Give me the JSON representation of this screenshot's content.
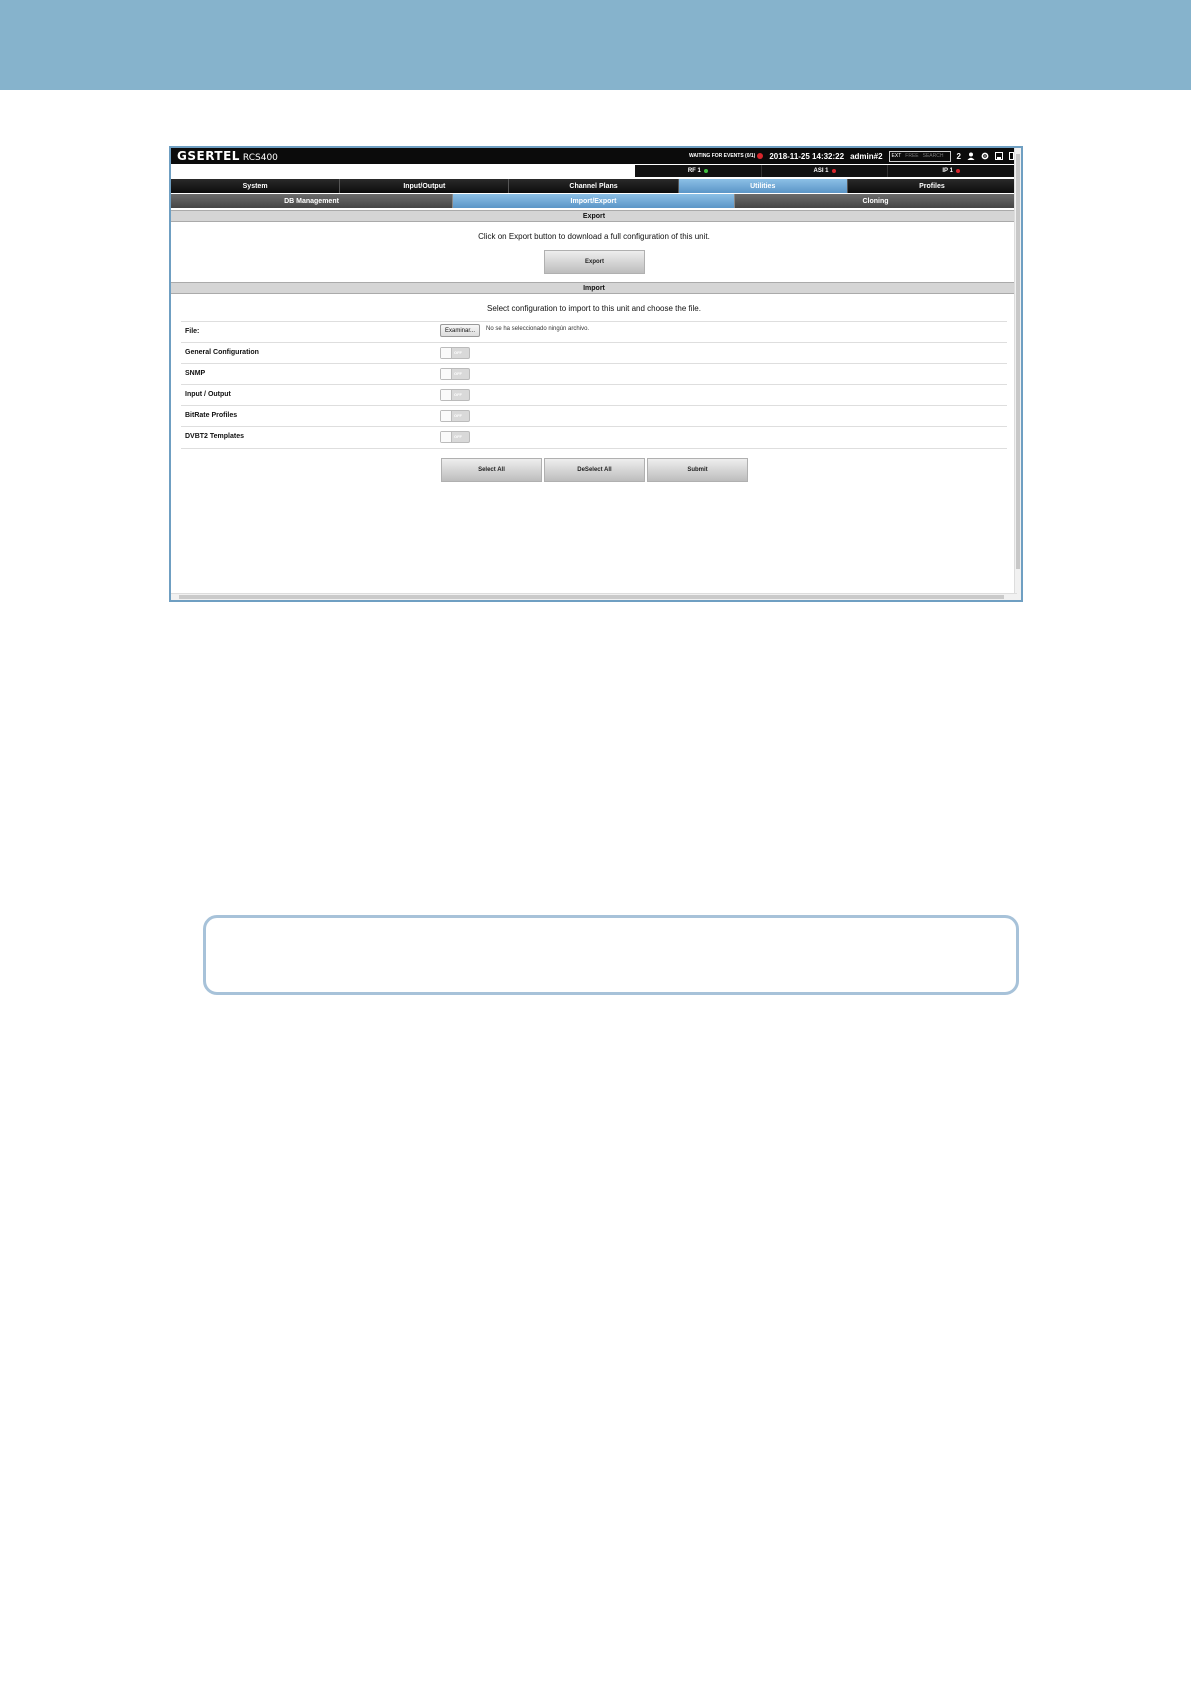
{
  "app": {
    "brand": "GSERTEL",
    "model": "RCS400",
    "status": "WAITING FOR EVENTS (0/1)",
    "datetime": "2018-11-25 14:32:22",
    "user": "admin#2",
    "ext_modes": [
      "EXT",
      "FREE",
      "SEARCH"
    ],
    "user_count": "2"
  },
  "status_blocks": [
    {
      "label": "RF 1",
      "dot_color": "#3fbf3f"
    },
    {
      "label": "ASI 1",
      "dot_color": "#d9262c"
    },
    {
      "label": "IP 1",
      "dot_color": "#d9262c"
    }
  ],
  "tabs": [
    "System",
    "Input/Output",
    "Channel Plans",
    "Utilities",
    "Profiles"
  ],
  "active_tab": "Utilities",
  "subtabs": [
    "DB Management",
    "Import/Export",
    "Cloning"
  ],
  "active_subtab": "Import/Export",
  "export": {
    "title": "Export",
    "message": "Click on Export button to download a full configuration of this unit.",
    "button": "Export"
  },
  "import": {
    "title": "Import",
    "message": "Select configuration to import to this unit and choose the file.",
    "file_label": "File:",
    "file_button": "Examinar...",
    "file_status": "No se ha seleccionado ningún archivo.",
    "toggle_off_label": "OFF",
    "options": [
      {
        "label": "General Configuration",
        "state": "OFF"
      },
      {
        "label": "SNMP",
        "state": "OFF"
      },
      {
        "label": "Input / Output",
        "state": "OFF"
      },
      {
        "label": "BitRate Profiles",
        "state": "OFF"
      },
      {
        "label": "DVBT2 Templates",
        "state": "OFF"
      }
    ],
    "buttons": {
      "select_all": "Select All",
      "deselect_all": "DeSelect All",
      "submit": "Submit"
    }
  },
  "colors": {
    "accent": "#6aa6d8",
    "header_band": "#86b3cc"
  }
}
